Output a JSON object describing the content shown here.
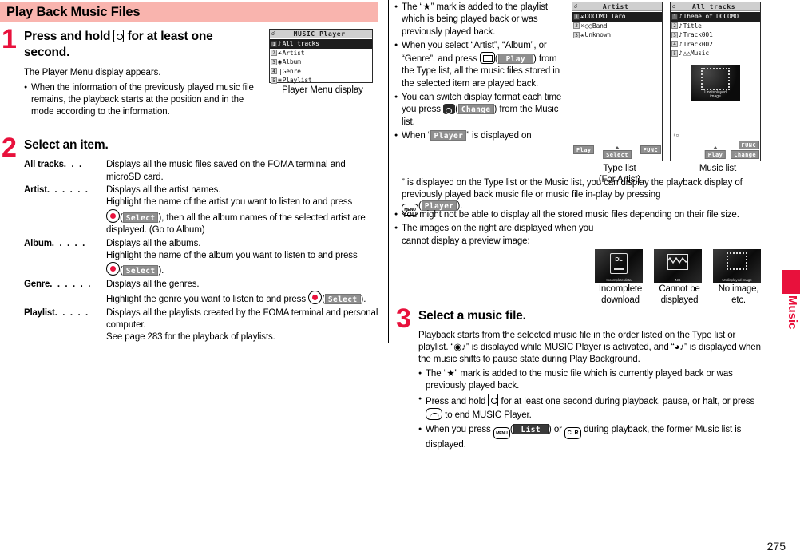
{
  "section": {
    "title": "Play Back Music Files"
  },
  "page": {
    "number": "275",
    "side_tab": "Music"
  },
  "steps": {
    "one": {
      "num": "1",
      "title_a": "Press and hold",
      "title_b": "for at least one second.",
      "para": "The Player Menu display appears.",
      "bullet1": "When the information of the previously played music file remains, the playback starts at the position and in the mode according to the information."
    },
    "two": {
      "num": "2",
      "title": "Select an item.",
      "items": [
        {
          "term": "All tracks",
          "dots": ". . .",
          "desc": "Displays all the music files saved on the FOMA terminal and microSD card.",
          "cont": []
        },
        {
          "term": "Artist",
          "dots": ". . . . . .",
          "desc": "Displays all the artist names.",
          "cont": []
        },
        {
          "term": "Album",
          "dots": ". . . . .",
          "desc": "Displays all the albums.",
          "cont": []
        },
        {
          "term": "Genre",
          "dots": ". . . . . .",
          "desc": "Displays all the genres.",
          "cont": []
        },
        {
          "term": "Playlist",
          "dots": ". . . . .",
          "desc": "Displays all the playlists created by the FOMA terminal and personal computer.",
          "cont": [
            "See page 283 for the playback of playlists."
          ]
        }
      ],
      "artist_cont_1": "Highlight the name of the artist you want to listen to and press",
      "artist_cont_2a": "),",
      "artist_cont_2b": "then all the album names of the selected artist are displayed. (Go to Album)",
      "album_cont_1": "Highlight the name of the album you want to listen to and press",
      "album_cont_2": ").",
      "genre_cont_1a": "Highlight the genre you want to listen to and press",
      "genre_cont_1b": ").",
      "select_chip": "Select"
    },
    "three": {
      "num": "3",
      "title": "Select a music file.",
      "para_a": "Playback starts from the selected music file in the order listed on the Type list or playlist. “",
      "para_b": "” is displayed while MUSIC Player is activated, and “",
      "para_c": "” is displayed when the music shifts to pause state during Play Background.",
      "bullets": [
        "The “★” mark is added to the music file which is currently played back or was previously played back."
      ],
      "bullet_press_a": "Press and hold",
      "bullet_press_b": "for at least one second during playback, pause, or halt, or press",
      "bullet_press_c": "to end MUSIC Player.",
      "bullet_menu_a": "When you press",
      "bullet_menu_b": ") or",
      "bullet_menu_c": "during playback, the former Music list is displayed.",
      "list_chip": "List",
      "clr_label": "CLR",
      "menu_label": "MENU"
    }
  },
  "right_notes": {
    "b1": "The “★” mark is added to the playlist which is being played back or was previously played back.",
    "b2_a": "When you select “Artist”, “Album”, or “Genre”, and press",
    "b2_chip": "Play",
    "b2_b": ") from the Type list, all the music files stored in the selected item are played back.",
    "b3_a": "You can switch display format each time you press",
    "b3_chip": "Change",
    "b3_b": ") from the Music list.",
    "b4_a": "When “",
    "b4_chip": "Player",
    "b4_b": "” is displayed on the Type list or the Music list, you can display the playback display of previously played back music file or music file in-play by pressing",
    "b4_chip2": "Player",
    "b4_c": ").",
    "b5": "You might not be able to display all the stored music files depending on their file size.",
    "b6": "The images on the right are displayed when you cannot display a preview image:"
  },
  "player_menu": {
    "status_title": "MUSIC Player",
    "rows": [
      {
        "num": "1",
        "glyph": "♪",
        "label": "All tracks",
        "selected": true
      },
      {
        "num": "2",
        "glyph": "⚹",
        "label": "Artist",
        "selected": false
      },
      {
        "num": "3",
        "glyph": "◉",
        "label": "Album",
        "selected": false
      },
      {
        "num": "4",
        "glyph": "‖",
        "label": "Genre",
        "selected": false
      },
      {
        "num": "5",
        "glyph": "≡",
        "label": "Playlist",
        "selected": false
      }
    ],
    "caption": "Player Menu display"
  },
  "type_list": {
    "status_title": "Artist",
    "rows": [
      {
        "num": "1",
        "glyph": "⚹",
        "label": "DOCOMO Taro",
        "selected": true
      },
      {
        "num": "2",
        "glyph": "⚹",
        "label": "○○Band",
        "selected": false
      },
      {
        "num": "3",
        "glyph": "⚹",
        "label": "Unknown",
        "selected": false
      }
    ],
    "soft_left": "Play",
    "soft_center": "Select",
    "soft_right": "FUNC",
    "caption_line1": "Type list",
    "caption_line2": "(For Artist)"
  },
  "music_list": {
    "status_title": "All tracks",
    "rows": [
      {
        "num": "1",
        "glyph": "♪",
        "label": "Theme of DOCOMO",
        "selected": true
      },
      {
        "num": "2",
        "glyph": "♪",
        "label": "Title",
        "selected": false
      },
      {
        "num": "3",
        "glyph": "♪",
        "label": "Track001",
        "selected": false
      },
      {
        "num": "4",
        "glyph": "♪",
        "label": "Track002",
        "selected": false
      },
      {
        "num": "5",
        "glyph": "♪",
        "label": "△△Music",
        "selected": false
      }
    ],
    "thumb_label_1": "Undisplayed",
    "thumb_label_2": "image",
    "soft_center": "Play",
    "soft_right1": "FUNC",
    "soft_right2": "Change",
    "caption": "Music list"
  },
  "error_icons": [
    {
      "badge": "DL",
      "sub": "Incomplete  data",
      "caption_line1": "Incomplete",
      "caption_line2": "download"
    },
    {
      "badge": "NG",
      "sub": "NG",
      "caption_line1": "Cannot be",
      "caption_line2": "displayed"
    },
    {
      "badge": "",
      "sub": "Undisplayed image",
      "caption_line1": "No image,",
      "caption_line2": "etc."
    }
  ],
  "colors": {
    "header_pink": "#f9b4ae",
    "accent_red": "#e8113c"
  }
}
